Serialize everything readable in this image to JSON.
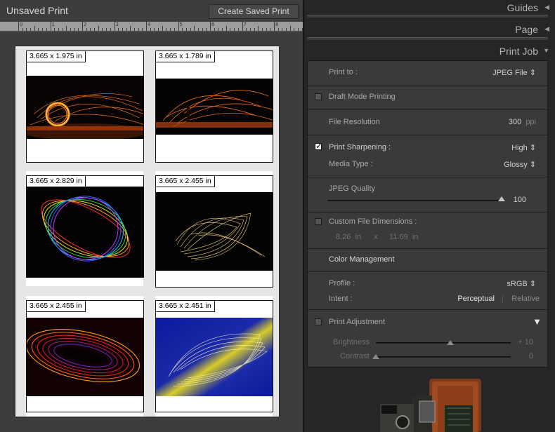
{
  "header": {
    "title": "Unsaved Print",
    "create_button": "Create Saved Print"
  },
  "ruler": {
    "marks": [
      "0",
      "1",
      "2",
      "3",
      "4",
      "5",
      "6",
      "7",
      "8"
    ]
  },
  "cells": [
    {
      "dimension": "3.665 x 1.975 in",
      "photo": "orange-ring-light-painting"
    },
    {
      "dimension": "3.665 x 1.789 in",
      "photo": "orange-fire-spin-silhouette"
    },
    {
      "dimension": "3.665 x 2.829 in",
      "photo": "rainbow-ellipse-light-painting"
    },
    {
      "dimension": "3.665 x 2.455 in",
      "photo": "golden-twisted-ribbon"
    },
    {
      "dimension": "3.665 x 2.455 in",
      "photo": "red-spiral-ellipse"
    },
    {
      "dimension": "3.665 x 2.451 in",
      "photo": "yellow-blue-twisted-ribbon"
    }
  ],
  "panel": {
    "guides": "Guides",
    "page": "Page",
    "print_job": "Print Job",
    "print_to_label": "Print to :",
    "print_to_value": "JPEG File",
    "draft_mode": "Draft Mode Printing",
    "file_resolution_label": "File Resolution",
    "file_resolution_value": "300",
    "file_resolution_unit": "ppi",
    "print_sharpening_label": "Print Sharpening :",
    "print_sharpening_value": "High",
    "media_type_label": "Media Type :",
    "media_type_value": "Glossy",
    "jpeg_quality_label": "JPEG Quality",
    "jpeg_quality_value": "100",
    "custom_dims_label": "Custom File Dimensions :",
    "custom_width": "8.26",
    "custom_height": "11.69",
    "unit_in": "in",
    "times": "x",
    "color_management": "Color Management",
    "profile_label": "Profile :",
    "profile_value": "sRGB",
    "intent_label": "Intent :",
    "intent_perceptual": "Perceptual",
    "intent_divider": "|",
    "intent_relative": "Relative",
    "print_adjustment": "Print Adjustment",
    "brightness_label": "Brightness",
    "brightness_value": "+ 10",
    "contrast_label": "Contrast",
    "contrast_value": "0",
    "sharpening_checked": true,
    "draft_checked": false,
    "custom_dims_checked": false,
    "adjustment_checked": false
  },
  "sliders": {
    "jpeg_quality_fraction": 1.0,
    "brightness_fraction": 0.55,
    "contrast_fraction": 0.0
  },
  "colors": {
    "panel_bg": "#262626",
    "section_bg": "#3a3a3a",
    "preview_bg": "#3d3d3d"
  }
}
